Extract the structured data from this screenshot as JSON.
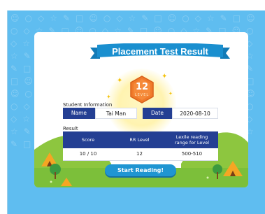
{
  "banner": {
    "title": "Placement Test Result"
  },
  "badge": {
    "level": "12",
    "sub": "LEVEL"
  },
  "student": {
    "section_label": "Student Information",
    "name_label": "Name",
    "name_value": "Tai Man",
    "date_label": "Date",
    "date_value": "2020-08-10"
  },
  "result": {
    "section_label": "Result",
    "headers": [
      "Score",
      "RR Level",
      "Lexile reading range for Level"
    ],
    "values": [
      "10 / 10",
      "12",
      "500-510"
    ]
  },
  "actions": {
    "start_label": "Start Reading!"
  },
  "colors": {
    "background": "#5fbdf0",
    "header_navy": "#243f93",
    "banner_blue": "#1a8fcf",
    "button_blue": "#1f95d2",
    "badge_orange": "#f07a2a",
    "grass_green": "#8dc63f"
  }
}
